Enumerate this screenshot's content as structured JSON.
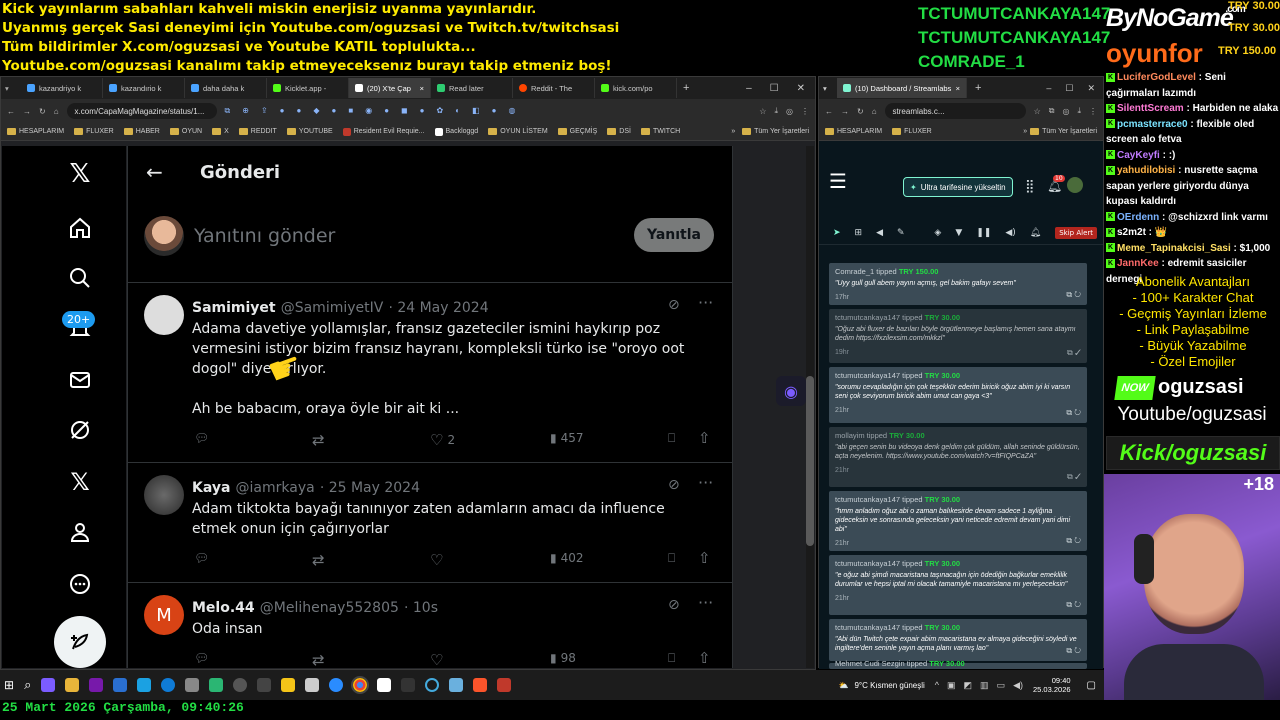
{
  "overlay": {
    "lines": [
      "Kick yayınlarım sabahları kahveli miskin enerjisiz uyanma yayınlarıdır.",
      "Uyanmış gerçek Sasi deneyimi için Youtube.com/oguzsasi ve Twitch.tv/twitchsasi",
      "Tüm bildirimler X.com/oguzsasi ve Youtube KATIL toplulukta...",
      "Youtube.com/oguzsasi kanalımı takip etmeyeceksenız burayı takip etmeniz boş!"
    ],
    "donors": [
      "TCTUMUTCANKAYA147",
      "TCTUMUTCANKAYA147",
      "COMRADE_1"
    ],
    "amounts": [
      "TRY 30.00",
      "TRY 30.00",
      "TRY 150.00"
    ],
    "logo_bynogame": "ByNoGame",
    "logo_dotcom": ".com",
    "logo_oyunfor": "oyunfor",
    "date": "25 Mart 2026 Çarşamba, 09:40:26"
  },
  "left_browser": {
    "tabs": [
      "kazandriyo k",
      "kazandırio k",
      "daha daha k",
      "Kicklet.app -",
      "(20) X'te Çap",
      "Read later",
      "Reddit - The",
      "kick.com/po"
    ],
    "url": "x.com/CapaMagMagazine/status/1...",
    "bookmarks": [
      "HESAPLARIM",
      "FLUXER",
      "HABER",
      "OYUN",
      "X",
      "REDDIT",
      "YOUTUBE",
      "Resident Evil Requie...",
      "Backloggd",
      "OYUN LİSTEM",
      "GEÇMİŞ",
      "DSİ",
      "TWITCH",
      "Tüm Yer İşaretleri"
    ]
  },
  "x": {
    "notif_badge": "20+",
    "header_title": "Gönderi",
    "reply_placeholder": "Yanıtını gönder",
    "reply_button": "Yanıtla",
    "tweets": [
      {
        "name": "Samimiyet",
        "handle": "@SamimiyetIV",
        "date": "· 24 May 2024",
        "body1": "Adama davetiye yollamışlar, fransız gazeteciler ismini haykırıp poz vermesini istiyor bizim fransız hayranı, kompleksli türko ise \"oroyo oot dogol\" diye zırlıyor.",
        "body2": "Ah be babacım, oraya öyle bir ait ki ...",
        "likes": "2",
        "views": "457"
      },
      {
        "name": "Kaya",
        "handle": "@iamrkaya",
        "date": "· 25 May 2024",
        "body1": "Adam tiktokta bayağı tanınıyor zaten adamların amacı da influence etmek onun için çağırıyorlar",
        "views": "402"
      },
      {
        "name": "Melo.44",
        "handle": "@Melihenay552805",
        "date": "· 10s",
        "body1": "Oda insan",
        "initial": "M",
        "views": "98"
      }
    ]
  },
  "right_browser": {
    "tab": "(10) Dashboard / Streamlabs",
    "url": "streamlabs.c...",
    "bookmarks": [
      "HESAPLARIM",
      "FLUXER",
      "Tüm Yer İşaretleri"
    ],
    "upgrade": "Ultra tarifesine yükseltin",
    "notif": "10",
    "skip": "Skip Alert",
    "cards": [
      {
        "who": "Comrade_1 tipped",
        "amt": "TRY 150.00",
        "msg": "\"Uyy gull gull abem yayını açmış, gel bakim gafayı sevem\"",
        "time": "17hr"
      },
      {
        "who": "tctumutcankaya147 tipped",
        "amt": "TRY 30.00",
        "msg": "\"Oğuz abi fluxer de bazıları böyle örgütlenmeye başlamış hemen sana ataymı dedim https://fxzilexsim.com/mkkzl\"",
        "time": "19hr"
      },
      {
        "who": "tctumutcankaya147 tipped",
        "amt": "TRY 30.00",
        "msg": "\"sorumu cevapladığın için çok teşekkür ederim biricik oğuz abim iyi ki varsın seni çok seviyorum biricik abim umut can gaya <3\"",
        "time": "21hr"
      },
      {
        "who": "mollayim tipped",
        "amt": "TRY 30.00",
        "msg": "\"abi geçen senin bu videoya denk geldim çok güldüm, allah seninde güldürsün, açta neyelenim. https://www.youtube.com/watch?v=ftFIQPCaZA\"",
        "time": "21hr"
      },
      {
        "who": "tctumutcankaya147 tipped",
        "amt": "TRY 30.00",
        "msg": "\"hmm anladım oğuz abi o zaman balıkesirde devam sadece 1 ayliğına gideceksin ve sonrasında geleceksin yani neticede edremit devam yani dimi abi\"",
        "time": "21hr"
      },
      {
        "who": "tctumutcankaya147 tipped",
        "amt": "TRY 30.00",
        "msg": "\"e oğuz abi şimdi macaristana taşınacağın için ödediğin bağkurlar emeklilik durumlar ve hepsi iptal mi olacak tamamiyle macaristana mı yerleşeceksin\"",
        "time": "21hr"
      },
      {
        "who": "tctumutcankaya147 tipped",
        "amt": "TRY 30.00",
        "msg": "\"Abi dün Twitch çete expair abim macaristana ev almaya gideceğini söyledi ve ingiltere'den seninle yayın açma planı varmış lao\"",
        "time": "21hr"
      },
      {
        "who": "Mehmet Cudi Sezgin tipped",
        "amt": "TRY 30.00",
        "msg": "",
        "time": ""
      }
    ]
  },
  "chat": [
    {
      "user": "LuciferGodLevel",
      "msg": "Seni çağırmaları lazımdı"
    },
    {
      "user": "SilenttScream",
      "msg": "Harbiden ne alaka"
    },
    {
      "user": "pcmasterrace0",
      "msg": "flexible oled screen alo fetva"
    },
    {
      "user": "CayKeyfi",
      "msg": ":)"
    },
    {
      "user": "yahudilobisi",
      "msg": "nusrette saçma sapan yerlere giriyordu dünya kupası kaldırdı"
    },
    {
      "user": "OErdenn",
      "msg": "@schizxrd link varmı"
    },
    {
      "user": "s2m2t",
      "msg": "👑"
    },
    {
      "user": "Meme_Tapinakcisi_Sasi",
      "msg": "$1,000"
    },
    {
      "user": "JannKee",
      "msg": "edremit sasiciler dernegi"
    }
  ],
  "perks": [
    "Abonelik Avantajları",
    "- 100+ Karakter Chat",
    "- Geçmiş Yayınları İzleme",
    "- Link Paylaşabilme",
    "- Büyük Yazabilme",
    "- Özel Emojiler"
  ],
  "brand": {
    "now": "NOW",
    "name": "oguzsasi",
    "youtube": "Youtube/oguzsasi",
    "kick": "Kick/oguzsasi",
    "plus": "+18"
  },
  "taskbar": {
    "weather": "9°C  Kısmen güneşli",
    "time": "09:40",
    "date": "25.03.2026"
  },
  "colors": {
    "kick_green": "#53fc18",
    "x_bg": "#000000",
    "overlay_yellow": "#ffeb00",
    "donor_green": "#22dd44"
  }
}
